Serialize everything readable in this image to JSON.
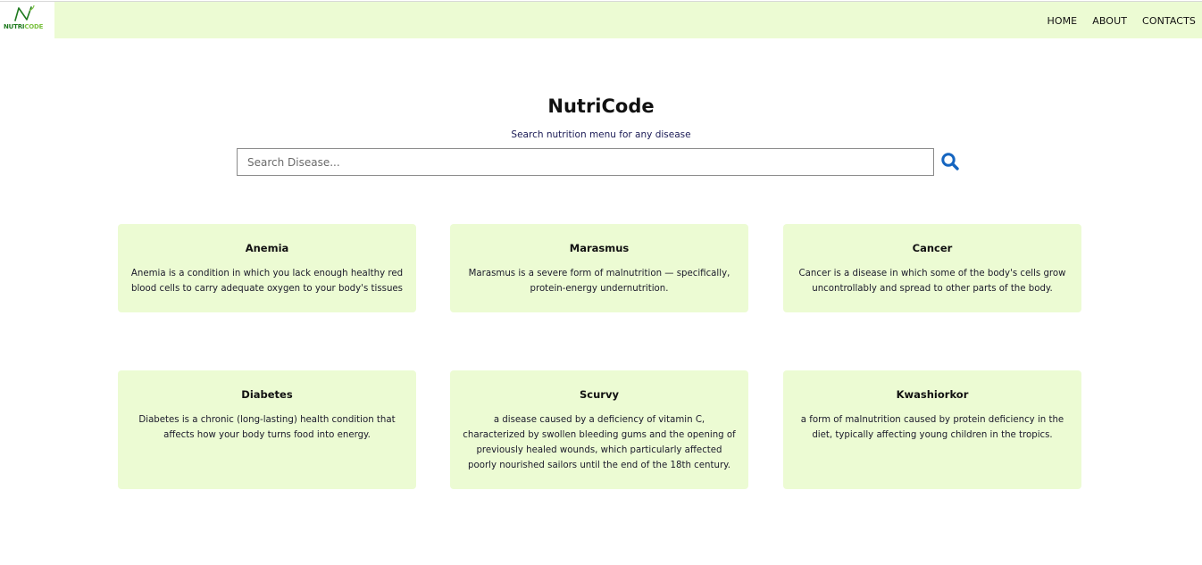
{
  "brand": {
    "logo_text_a": "N",
    "logo_text_b": "UTRI",
    "logo_text_c": "C",
    "logo_text_d": "ODE"
  },
  "nav": {
    "items": [
      {
        "label": "HOME"
      },
      {
        "label": "ABOUT"
      },
      {
        "label": "CONTACTS"
      }
    ]
  },
  "hero": {
    "title": "NutriCode",
    "subtitle": "Search nutrition menu for any disease"
  },
  "search": {
    "placeholder": "Search Disease...",
    "value": "",
    "icon": "search-icon"
  },
  "cards": [
    {
      "title": "Anemia",
      "description": "Anemia is a condition in which you lack enough healthy red blood cells to carry adequate oxygen to your body's tissues"
    },
    {
      "title": "Marasmus",
      "description": "Marasmus is a severe form of malnutrition — specifically, protein-energy undernutrition."
    },
    {
      "title": "Cancer",
      "description": "Cancer is a disease in which some of the body's cells grow uncontrollably and spread to other parts of the body."
    },
    {
      "title": "Diabetes",
      "description": "Diabetes is a chronic (long-lasting) health condition that affects how your body turns food into energy."
    },
    {
      "title": "Scurvy",
      "description": "a disease caused by a deficiency of vitamin C, characterized by swollen bleeding gums and the opening of previously healed wounds, which particularly affected poorly nourished sailors until the end of the 18th century."
    },
    {
      "title": "Kwashiorkor",
      "description": "a form of malnutrition caused by protein deficiency in the diet, typically affecting young children in the tropics."
    }
  ],
  "colors": {
    "nav_bg": "#ecfbd3",
    "card_bg": "#ecfbd3",
    "accent": "#1565c0",
    "brand_dark": "#1f7a1f",
    "brand_light": "#7cc242"
  }
}
